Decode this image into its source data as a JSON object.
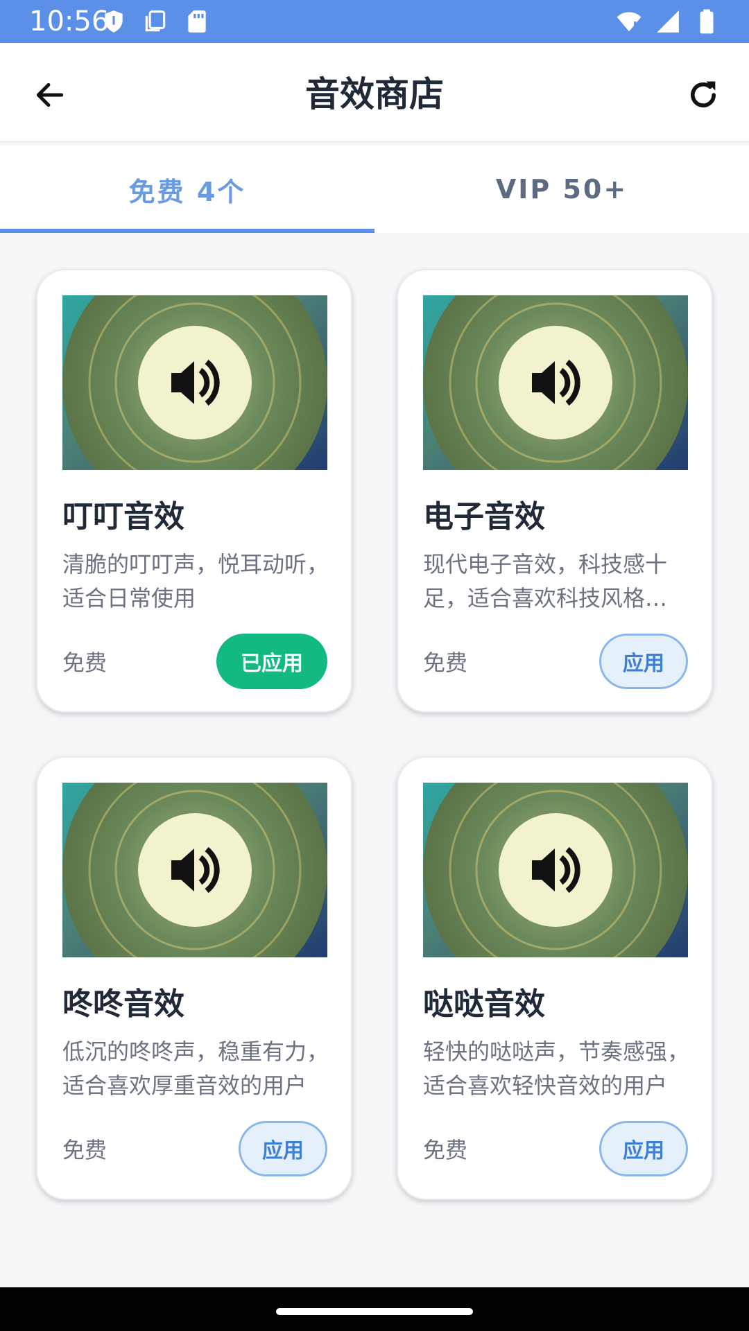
{
  "status_bar": {
    "time": "10:56",
    "left_icons": [
      "shield-icon",
      "copy-icon",
      "sd-card-icon"
    ],
    "right_icons": [
      "wifi-icon",
      "signal-icon",
      "battery-icon"
    ],
    "background": "#5b8fe8"
  },
  "app_bar": {
    "title": "音效商店",
    "back_icon": "back-arrow-icon",
    "refresh_icon": "refresh-icon"
  },
  "tabs": [
    {
      "label": "免费 4个",
      "active": true
    },
    {
      "label": "VIP 50+",
      "active": false
    }
  ],
  "cards": [
    {
      "title": "叮叮音效",
      "description": "清脆的叮叮声，悦耳动听，适合日常使用",
      "price": "免费",
      "button": "已应用",
      "applied": true
    },
    {
      "title": "电子音效",
      "description": "现代电子音效，科技感十足，适合喜欢科技风格的用户",
      "price": "免费",
      "button": "应用",
      "applied": false
    },
    {
      "title": "咚咚音效",
      "description": "低沉的咚咚声，稳重有力，适合喜欢厚重音效的用户",
      "price": "免费",
      "button": "应用",
      "applied": false
    },
    {
      "title": "哒哒音效",
      "description": "轻快的哒哒声，节奏感强，适合喜欢轻快音效的用户",
      "price": "免费",
      "button": "应用",
      "applied": false
    }
  ],
  "colors": {
    "accent": "#5b8fe8",
    "applied_green": "#12b981",
    "apply_button_bg": "#e6f0fb"
  }
}
